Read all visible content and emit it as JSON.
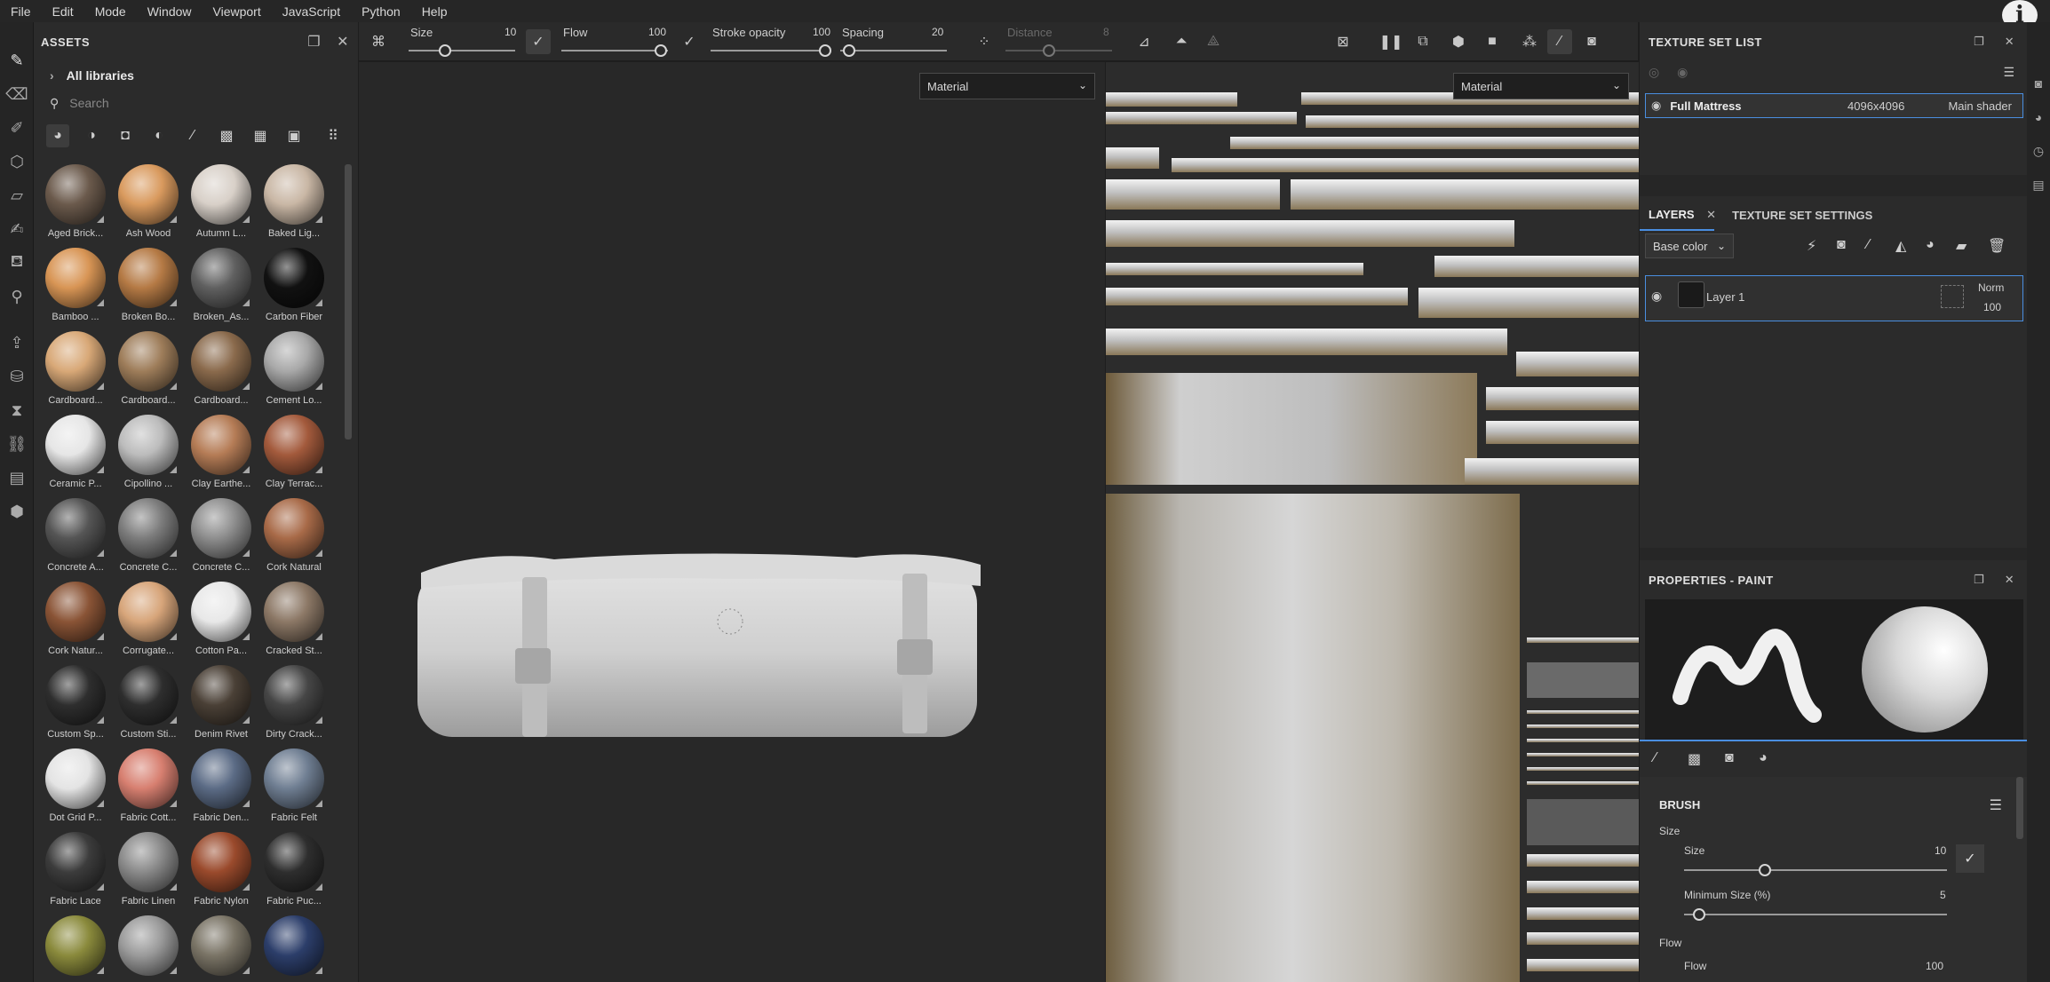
{
  "menu": [
    "File",
    "Edit",
    "Mode",
    "Window",
    "Viewport",
    "JavaScript",
    "Python",
    "Help"
  ],
  "assets": {
    "title": "ASSETS",
    "all_libraries": "All libraries",
    "search_placeholder": "Search",
    "materials": [
      {
        "label": "Aged Brick...",
        "color": "#6b5a4c"
      },
      {
        "label": "Ash Wood",
        "color": "#d99a5e"
      },
      {
        "label": "Autumn L...",
        "color": "#d8d0c8"
      },
      {
        "label": "Baked Lig...",
        "color": "#c9b7a5"
      },
      {
        "label": "Bamboo ...",
        "color": "#d89555"
      },
      {
        "label": "Broken Bo...",
        "color": "#b57a45"
      },
      {
        "label": "Broken_As...",
        "color": "#606060"
      },
      {
        "label": "Carbon Fiber",
        "color": "#111111"
      },
      {
        "label": "Cardboard...",
        "color": "#d8a877"
      },
      {
        "label": "Cardboard...",
        "color": "#9e7d5a"
      },
      {
        "label": "Cardboard...",
        "color": "#8a6a4c"
      },
      {
        "label": "Cement Lo...",
        "color": "#a8a8a8"
      },
      {
        "label": "Ceramic P...",
        "color": "#e6e6e6"
      },
      {
        "label": "Cipollino ...",
        "color": "#bcbcbc"
      },
      {
        "label": "Clay Earthe...",
        "color": "#b57c56"
      },
      {
        "label": "Clay Terrac...",
        "color": "#a35a3c"
      },
      {
        "label": "Concrete A...",
        "color": "#555555"
      },
      {
        "label": "Concrete C...",
        "color": "#7c7c7c"
      },
      {
        "label": "Concrete C...",
        "color": "#8e8e8e"
      },
      {
        "label": "Cork Natural",
        "color": "#a86a48"
      },
      {
        "label": "Cork Natur...",
        "color": "#8a5436"
      },
      {
        "label": "Corrugate...",
        "color": "#d7a57a"
      },
      {
        "label": "Cotton Pa...",
        "color": "#e8e8e8"
      },
      {
        "label": "Cracked St...",
        "color": "#8c7866"
      },
      {
        "label": "Custom Sp...",
        "color": "#2e2e2e"
      },
      {
        "label": "Custom Sti...",
        "color": "#2e2e2e"
      },
      {
        "label": "Denim Rivet",
        "color": "#4a4036"
      },
      {
        "label": "Dirty Crack...",
        "color": "#464646"
      },
      {
        "label": "Dot Grid P...",
        "color": "#e4e4e4"
      },
      {
        "label": "Fabric Cott...",
        "color": "#d77f70"
      },
      {
        "label": "Fabric Den...",
        "color": "#5b6b85"
      },
      {
        "label": "Fabric Felt",
        "color": "#6f7e92"
      },
      {
        "label": "Fabric Lace",
        "color": "#3c3c3c"
      },
      {
        "label": "Fabric Linen",
        "color": "#8a8a8a"
      },
      {
        "label": "Fabric Nylon",
        "color": "#9a4a2c"
      },
      {
        "label": "Fabric Puc...",
        "color": "#2e2e2e"
      },
      {
        "label": "",
        "color": "#8a8a3c"
      },
      {
        "label": "",
        "color": "#9a9a9a"
      },
      {
        "label": "",
        "color": "#7a7466"
      },
      {
        "label": "",
        "color": "#2c3e6a"
      }
    ]
  },
  "toolbar": {
    "size_label": "Size",
    "size_value": "10",
    "flow_label": "Flow",
    "flow_value": "100",
    "stroke_label": "Stroke opacity",
    "stroke_value": "100",
    "spacing_label": "Spacing",
    "spacing_value": "20",
    "distance_label": "Distance",
    "distance_value": "8"
  },
  "viewport": {
    "left_mode": "Material",
    "right_mode": "Material"
  },
  "texture_set_list": {
    "title": "TEXTURE SET LIST",
    "name": "Full Mattress",
    "resolution": "4096x4096",
    "shader": "Main shader"
  },
  "layers": {
    "tab_layers": "LAYERS",
    "tab_settings": "TEXTURE SET SETTINGS",
    "channel": "Base color",
    "layer_name": "Layer 1",
    "blend": "Norm",
    "opacity": "100"
  },
  "properties": {
    "title": "PROPERTIES - PAINT",
    "brush_title": "BRUSH",
    "size_section": "Size",
    "size_label": "Size",
    "size_value": "10",
    "min_size_label": "Minimum Size (%)",
    "min_size_value": "5",
    "flow_section": "Flow",
    "flow_label": "Flow",
    "flow_value": "100"
  }
}
